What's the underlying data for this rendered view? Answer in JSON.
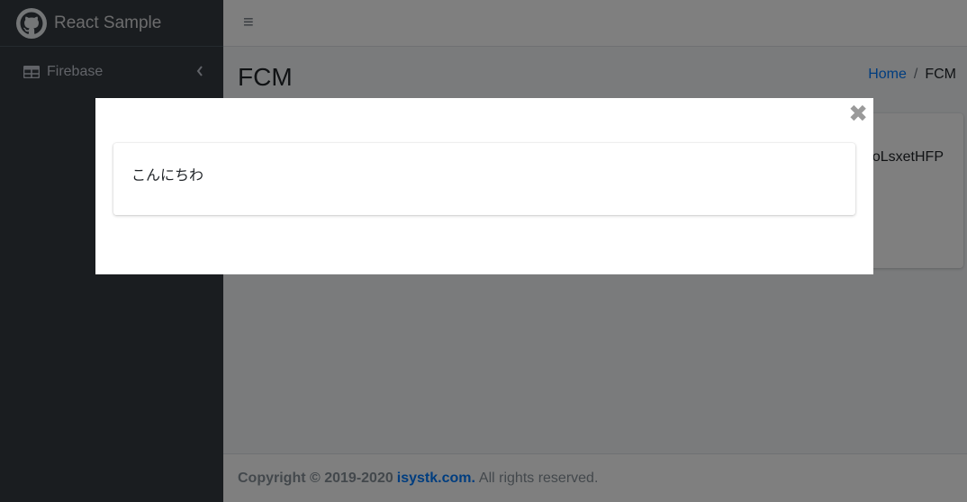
{
  "sidebar": {
    "brand": {
      "title": "React Sample",
      "logo_icon": "github-icon"
    },
    "items": [
      {
        "label": "Firebase",
        "icon": "table-icon",
        "chevron": "‹"
      }
    ]
  },
  "topbar": {
    "menu_icon": "≡"
  },
  "main": {
    "page_title": "FCM",
    "breadcrumb": [
      {
        "label": "Home"
      },
      {
        "label": "FCM"
      }
    ],
    "breadcrumb_separator": "/",
    "card": {
      "token_text": "oLsxetHFP"
    }
  },
  "footer": {
    "copyright": "Copyright © 2019-2020",
    "link": "isystk.com.",
    "rights": "All rights reserved."
  },
  "modal": {
    "close_label": "✖",
    "message": "こんにちわ"
  },
  "colors": {
    "sidebar_bg": "#343a40",
    "accent": "#007bff",
    "overlay": "rgba(0,0,0,0.5)"
  }
}
